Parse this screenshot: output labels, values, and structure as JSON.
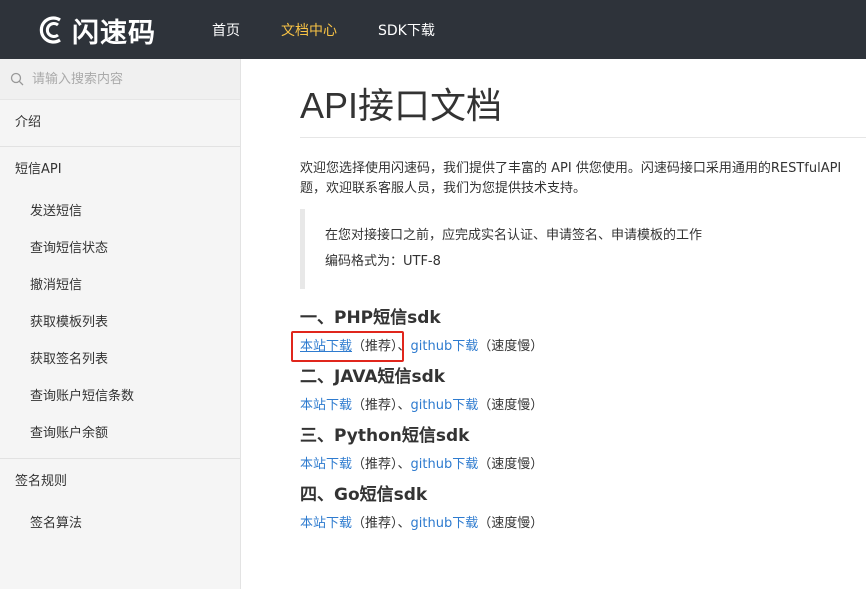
{
  "header": {
    "logo_text": "闪速码",
    "nav": [
      {
        "label": "首页",
        "active": false
      },
      {
        "label": "文档中心",
        "active": true
      },
      {
        "label": "SDK下载",
        "active": false
      }
    ],
    "active_color": "#f7c245",
    "bg_color": "#2e333a"
  },
  "sidebar": {
    "search_placeholder": "请输入搜索内容",
    "intro": "介绍",
    "sms_api": {
      "label": "短信API",
      "items": [
        "发送短信",
        "查询短信状态",
        "撤消短信",
        "获取模板列表",
        "获取签名列表",
        "查询账户短信条数",
        "查询账户余额"
      ]
    },
    "sign_rules": {
      "label": "签名规则",
      "items": [
        "签名算法"
      ]
    }
  },
  "main": {
    "title": "API接口文档",
    "intro_line1": "欢迎您选择使用闪速码，我们提供了丰富的 API 供您使用。闪速码接口采用通用的RESTfulAPI",
    "intro_line2": "题，欢迎联系客服人员，我们为您提供技术支持。",
    "note_line1": "在您对接接口之前，应完成实名认证、申请签名、申请模板的工作",
    "note_line2": "编码格式为：UTF-8",
    "sdks": [
      {
        "heading": "一、PHP短信sdk",
        "local_link": "本站下载",
        "local_note": "（推荐）",
        "sep": "、",
        "github_link": "github下载",
        "github_note": "（速度慢）"
      },
      {
        "heading": "二、JAVA短信sdk",
        "local_link": "本站下载",
        "local_note": "（推荐）",
        "sep": "、",
        "github_link": "github下载",
        "github_note": "（速度慢）"
      },
      {
        "heading": "三、Python短信sdk",
        "local_link": "本站下载",
        "local_note": "（推荐）",
        "sep": "、",
        "github_link": "github下载",
        "github_note": "（速度慢）"
      },
      {
        "heading": "四、Go短信sdk",
        "local_link": "本站下载",
        "local_note": "（推荐）",
        "sep": "、",
        "github_link": "github下载",
        "github_note": "（速度慢）"
      }
    ],
    "link_color": "#2e7bcf",
    "highlight_color": "#e0261c"
  }
}
